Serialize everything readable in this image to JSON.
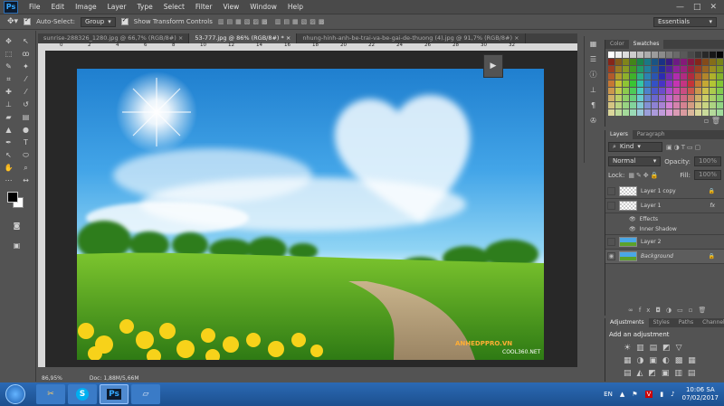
{
  "app": {
    "logo": "Ps"
  },
  "menu": [
    "File",
    "Edit",
    "Image",
    "Layer",
    "Type",
    "Select",
    "Filter",
    "View",
    "Window",
    "Help"
  ],
  "window_buttons": [
    "—",
    "□",
    "✕"
  ],
  "options": {
    "auto_select_label": "Auto-Select:",
    "auto_select_value": "Group",
    "transform_label": "Show Transform Controls",
    "workspace": "Essentials"
  },
  "tabs": [
    "sunrise-288326_1280.jpg @ 66,7% (RGB/8#)",
    "53-777.jpg @ 86% (RGB/8#) *",
    "nhung-hinh-anh-be-trai-va-be-gai-de-thuong (4).jpg @ 91,7% (RGB/8#)"
  ],
  "ruler_numbers": [
    "0",
    "2",
    "4",
    "6",
    "8",
    "10",
    "12",
    "14",
    "16",
    "18",
    "20",
    "22",
    "24",
    "26",
    "28",
    "30",
    "32"
  ],
  "canvas": {
    "watermark_brand": "ANHEDPPRO.VN",
    "watermark_site": "COOL360.NET"
  },
  "status": {
    "zoom": "86,95%",
    "doc": "Doc: 1,88M/5,66M"
  },
  "color_panel": {
    "tabs": [
      "Color",
      "Swatches"
    ]
  },
  "layers_panel": {
    "tabs": [
      "Layers",
      "Paragraph"
    ],
    "kind": "Kind",
    "blend": "Normal",
    "opacity_label": "Opacity:",
    "opacity_value": "100%",
    "lock_label": "Lock:",
    "fill_label": "Fill:",
    "fill_value": "100%",
    "layers": [
      {
        "name": "Layer 1 copy"
      },
      {
        "name": "Layer 1",
        "fx": "fx"
      },
      {
        "name": "Effects"
      },
      {
        "name": "Inner Shadow"
      },
      {
        "name": "Layer 2"
      },
      {
        "name": "Background"
      }
    ]
  },
  "adjustments_panel": {
    "tabs": [
      "Adjustments",
      "Styles",
      "Paths",
      "Channel"
    ],
    "title": "Add an adjustment"
  },
  "taskbar": {
    "apps": [
      "Ps"
    ],
    "lang": "EN",
    "time": "10:06 SA",
    "date": "07/02/2017"
  },
  "colors": {
    "panel_bg": "#535353",
    "accent_ps": "#34a8ff",
    "taskbar": "#2b6ab5"
  }
}
